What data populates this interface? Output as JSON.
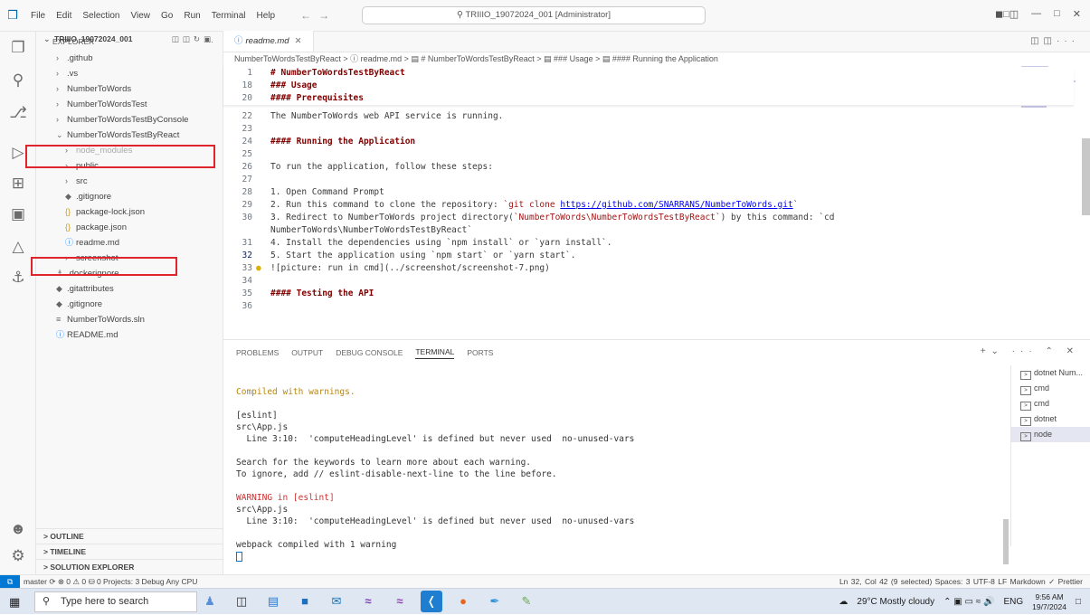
{
  "titlebar": {
    "menu": [
      "File",
      "Edit",
      "Selection",
      "View",
      "Go",
      "Run",
      "Terminal",
      "Help"
    ],
    "command_center": "TRIIIO_19072024_001 [Administrator]"
  },
  "sidebar": {
    "header": "EXPLORER",
    "root": "TRIIIO_19072024_001",
    "items": [
      {
        "label": ".github",
        "icon": "chevron-right"
      },
      {
        "label": ".vs",
        "icon": "chevron-right"
      },
      {
        "label": "NumberToWords",
        "icon": "chevron-right"
      },
      {
        "label": "NumberToWordsTest",
        "icon": "chevron-right"
      },
      {
        "label": "NumberToWordsTestByConsole",
        "icon": "chevron-right"
      },
      {
        "label": "NumberToWordsTestByReact",
        "icon": "chevron-down"
      },
      {
        "label": "node_modules",
        "icon": "chevron-right"
      },
      {
        "label": "public",
        "icon": "chevron-right"
      },
      {
        "label": "src",
        "icon": "chevron-right"
      },
      {
        "label": ".gitignore",
        "icon": "git-icon"
      },
      {
        "label": "package-lock.json",
        "icon": "json-icon"
      },
      {
        "label": "package.json",
        "icon": "json-icon"
      },
      {
        "label": "readme.md",
        "icon": "info-icon"
      },
      {
        "label": "screenshot",
        "icon": "chevron-right"
      },
      {
        "label": ".dockerignore",
        "icon": "docker-icon"
      },
      {
        "label": ".gitattributes",
        "icon": "git-icon"
      },
      {
        "label": ".gitignore",
        "icon": "git-icon"
      },
      {
        "label": "NumberToWords.sln",
        "icon": "sln-icon"
      },
      {
        "label": "README.md",
        "icon": "info-icon"
      }
    ],
    "sections": [
      "OUTLINE",
      "TIMELINE",
      "SOLUTION EXPLORER"
    ]
  },
  "editor": {
    "tab": "readme.md",
    "breadcrumb": "NumberToWordsTestByReact > ⓘ readme.md > ▤ # NumberToWordsTestByReact > ▤ ### Usage > ▤ #### Running the Application",
    "sticky": [
      {
        "n": "1",
        "t": "# NumberToWordsTestByReact"
      },
      {
        "n": "18",
        "t": "### Usage"
      },
      {
        "n": "20",
        "t": "#### Prerequisites"
      }
    ],
    "lines": [
      {
        "n": "22",
        "t": "The NumberToWords web API service is running."
      },
      {
        "n": "23",
        "t": ""
      },
      {
        "n": "24",
        "t": "#### Running the Application"
      },
      {
        "n": "25",
        "t": ""
      },
      {
        "n": "26",
        "t": "To run the application, follow these steps:"
      },
      {
        "n": "27",
        "t": ""
      },
      {
        "n": "28",
        "t": "1. Open Command Prompt"
      },
      {
        "n": "29",
        "a": "2. Run this command to clone the repository: ",
        "c": "`git clone ",
        "l": "https://github.com/SNARRANS/NumberToWords.git",
        "e": "`"
      },
      {
        "n": "30",
        "a": "3. Redirect to NumberToWords project directory(",
        "c": "`NumberToWords\\NumberToWordsTestByReact`",
        "e": ") by this command: `cd"
      },
      {
        "n": "",
        "t": "NumberToWords\\NumberToWordsTestByReact`"
      },
      {
        "n": "31",
        "t": "4. Install the dependencies using `npm install` or `yarn install`."
      },
      {
        "n": "32",
        "t": "5. Start the application using `npm start` or `yarn start`."
      },
      {
        "n": "33",
        "t": "![picture: run in cmd](../screenshot/screenshot-7.png)"
      },
      {
        "n": "34",
        "t": ""
      },
      {
        "n": "35",
        "t": "#### Testing the API"
      },
      {
        "n": "36",
        "t": ""
      }
    ]
  },
  "panel": {
    "tabs": [
      "PROBLEMS",
      "OUTPUT",
      "DEBUG CONSOLE",
      "TERMINAL",
      "PORTS"
    ],
    "terminal_lines": [
      "",
      "Compiled with warnings.",
      "",
      "[eslint]",
      "src\\App.js",
      "  Line 3:10:  'computeHeadingLevel' is defined but never used  no-unused-vars",
      "",
      "Search for the keywords to learn more about each warning.",
      "To ignore, add // eslint-disable-next-line to the line before.",
      "",
      "WARNING in [eslint]",
      "src\\App.js",
      "  Line 3:10:  'computeHeadingLevel' is defined but never used  no-unused-vars",
      "",
      "webpack compiled with 1 warning"
    ],
    "terminals": [
      "dotnet Num...",
      "cmd",
      "cmd",
      "dotnet",
      "node"
    ]
  },
  "statusbar": {
    "left": "master ⟳  ⊗ 0 ⚠ 0   ⛁ 0   Projects: 3   Debug Any CPU",
    "right": "Ln 32, Col 42 (9 selected)   Spaces: 3   UTF-8   LF   Markdown   ✓ Prettier"
  },
  "taskbar": {
    "search_placeholder": "Type here to search",
    "weather": "29°C  Mostly cloudy",
    "lang": "ENG",
    "time": "9:56 AM",
    "date": "19/7/2024"
  },
  "colors": {
    "accent": "#0078d4",
    "highlight_box": "#e0242c"
  }
}
